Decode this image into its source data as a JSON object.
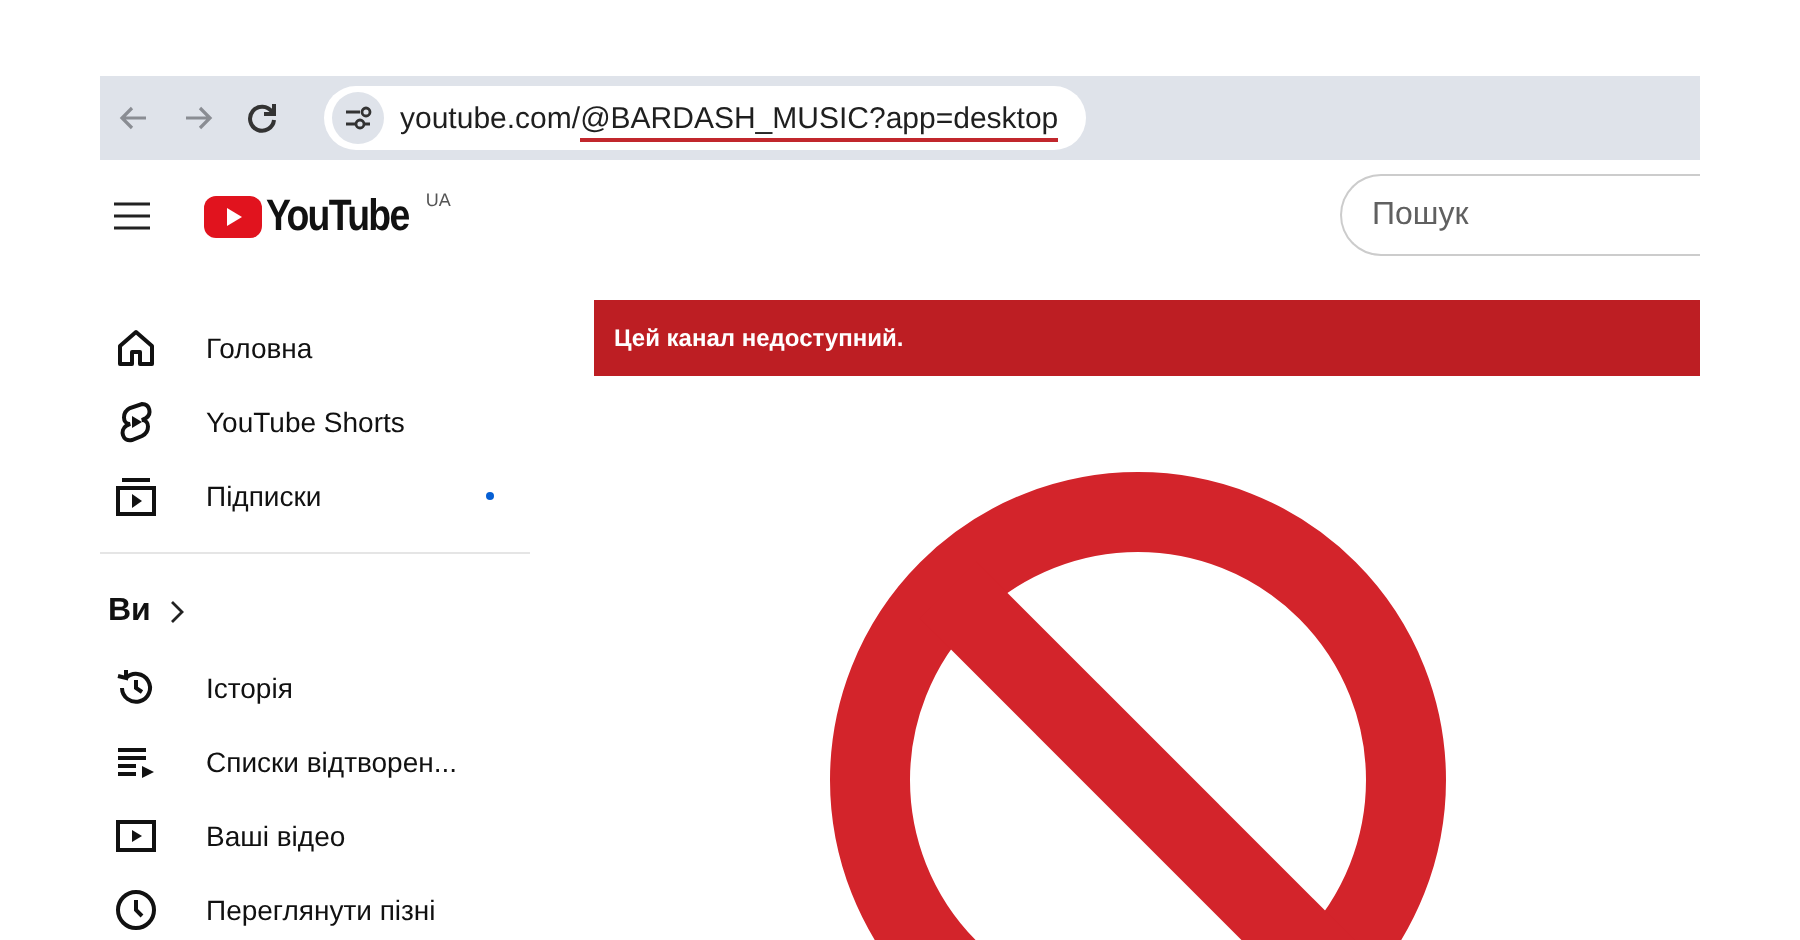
{
  "browser": {
    "url_host": "youtube.com/",
    "url_path": "@BARDASH_MUSIC?app=desktop",
    "url_path_underlined": true
  },
  "header": {
    "logo_text": "YouTube",
    "region": "UA",
    "search": {
      "placeholder": "Пошук"
    }
  },
  "sidebar": {
    "sections": [
      {
        "items": [
          {
            "kind": "home",
            "label": "Головна",
            "has_new": false
          },
          {
            "kind": "shorts",
            "label": "YouTube Shorts",
            "has_new": false
          },
          {
            "kind": "subscriptions",
            "label": "Підписки",
            "has_new": true
          }
        ]
      },
      {
        "heading": "Ви",
        "items": [
          {
            "kind": "history",
            "label": "Історія",
            "has_new": false
          },
          {
            "kind": "playlists",
            "label": "Списки відтворен...",
            "has_new": false
          },
          {
            "kind": "videos",
            "label": "Ваші відео",
            "has_new": false
          },
          {
            "kind": "later",
            "label": "Переглянути пізні",
            "has_new": false
          }
        ]
      }
    ]
  },
  "main": {
    "banner": "Цей канал недоступний."
  }
}
